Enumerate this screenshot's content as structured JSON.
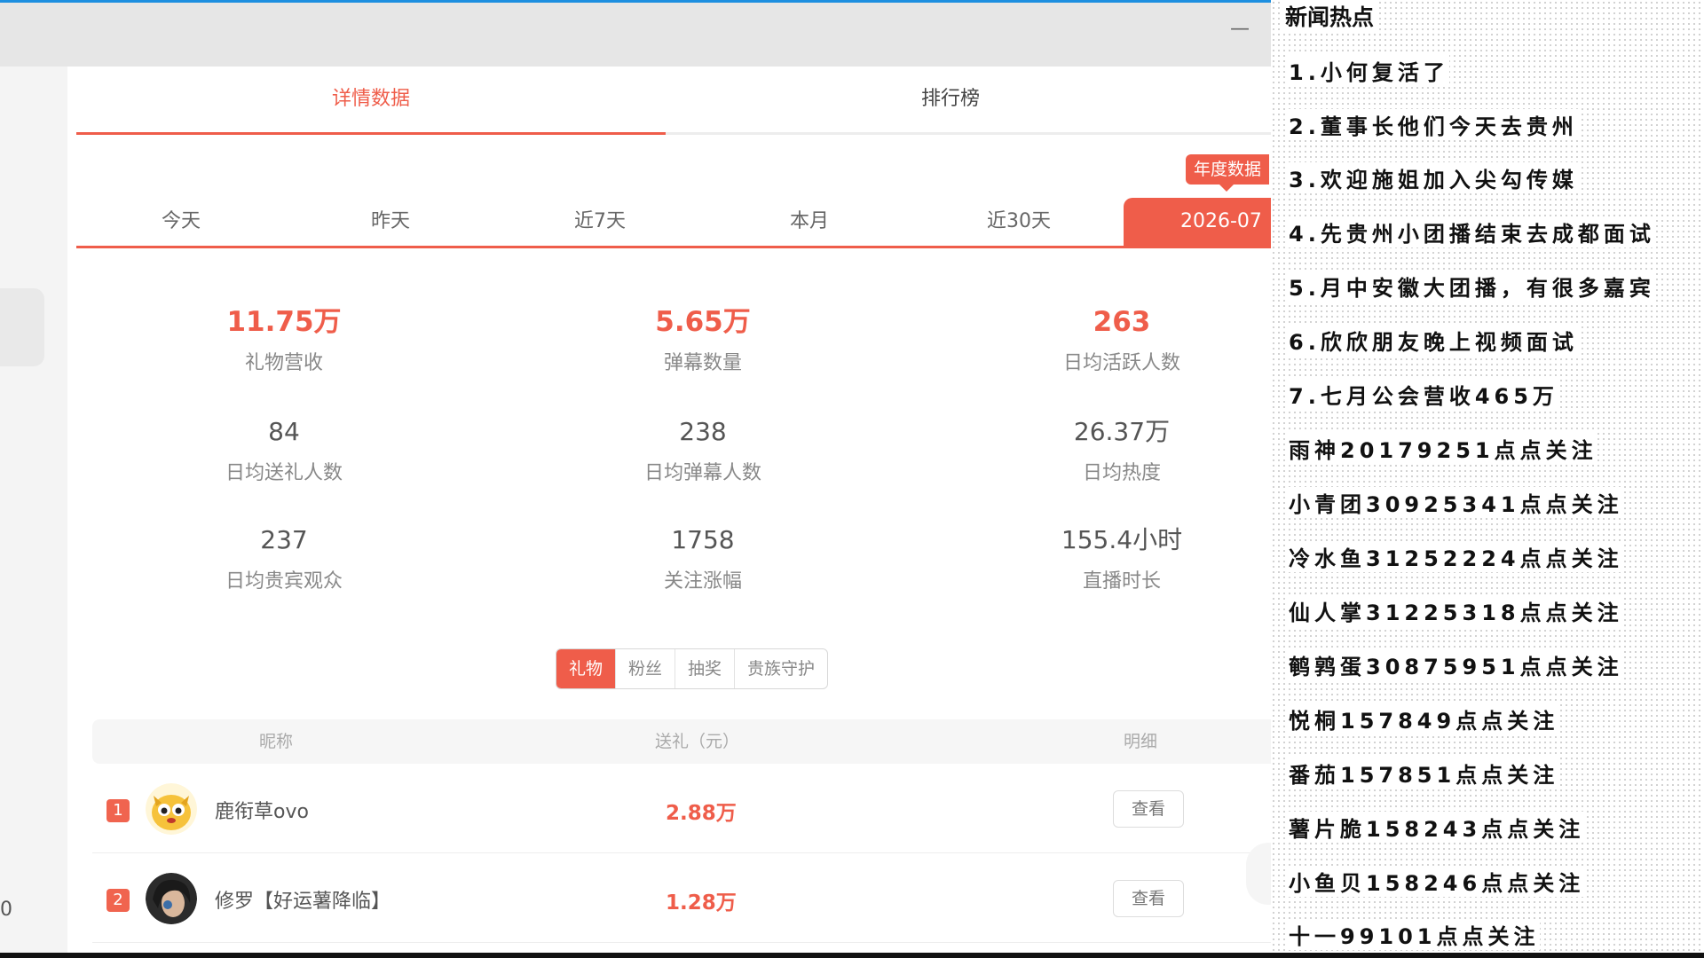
{
  "window": {
    "minimize_label": "—",
    "left_stub": "0"
  },
  "main_tabs": [
    {
      "label": "详情数据",
      "active": true
    },
    {
      "label": "排行榜",
      "active": false
    }
  ],
  "annual_badge": "年度数据",
  "period_tabs": [
    {
      "label": "今天"
    },
    {
      "label": "昨天"
    },
    {
      "label": "近7天"
    },
    {
      "label": "本月"
    },
    {
      "label": "近30天"
    },
    {
      "label": "2026-07",
      "active": true
    }
  ],
  "stats": [
    {
      "value": "11.75万",
      "label": "礼物营收",
      "highlight": true
    },
    {
      "value": "5.65万",
      "label": "弹幕数量",
      "highlight": true
    },
    {
      "value": "263",
      "label": "日均活跃人数",
      "highlight": true
    },
    {
      "value": "84",
      "label": "日均送礼人数"
    },
    {
      "value": "238",
      "label": "日均弹幕人数"
    },
    {
      "value": "26.37万",
      "label": "日均热度"
    },
    {
      "value": "237",
      "label": "日均贵宾观众"
    },
    {
      "value": "1758",
      "label": "关注涨幅"
    },
    {
      "value": "155.4小时",
      "label": "直播时长"
    }
  ],
  "segments": [
    {
      "label": "礼物",
      "active": true
    },
    {
      "label": "粉丝"
    },
    {
      "label": "抽奖"
    },
    {
      "label": "贵族守护"
    }
  ],
  "table": {
    "headers": {
      "nickname": "昵称",
      "gift": "送礼（元）",
      "detail": "明细"
    },
    "rows": [
      {
        "rank": "1",
        "nickname": "鹿衔草ovo",
        "gift": "2.88万",
        "action": "查看"
      },
      {
        "rank": "2",
        "nickname": "修罗【好运薯降临】",
        "gift": "1.28万",
        "action": "查看"
      }
    ]
  },
  "news": {
    "title": "新闻热点",
    "items": [
      "1.小何复活了",
      "2.董事长他们今天去贵州",
      "3.欢迎施姐加入尖勾传媒",
      "4.先贵州小团播结束去成都面试",
      "5.月中安徽大团播，有很多嘉宾",
      "6.欣欣朋友晚上视频面试",
      "7.七月公会营收465万",
      "雨神20179251点点关注",
      "小青团30925341点点关注",
      "冷水鱼31252224点点关注",
      "仙人掌31225318点点关注",
      "鹌鹑蛋30875951点点关注",
      "悦桐157849点点关注",
      "番茄157851点点关注",
      "薯片脆158243点点关注",
      "小鱼贝158246点点关注",
      "十一99101点点关注"
    ]
  },
  "colors": {
    "accent": "#ef5d4a",
    "titlebar": "#e6e6e6"
  }
}
